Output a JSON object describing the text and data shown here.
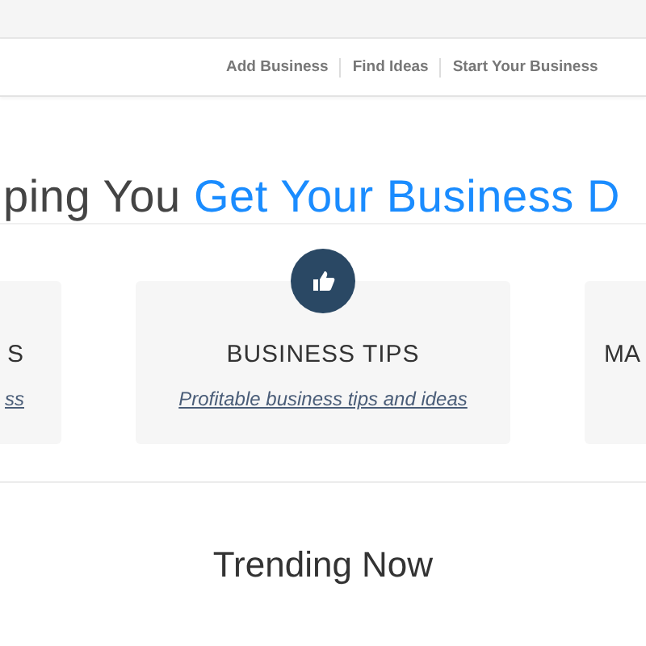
{
  "nav": {
    "links": [
      "Add Business",
      "Find Ideas",
      "Start Your Business"
    ]
  },
  "hero": {
    "heading_plain": "ping You",
    "heading_highlight": "Get Your Business D"
  },
  "cards": [
    {
      "kind": "cut-left",
      "title": "S",
      "link": "ss"
    },
    {
      "kind": "full",
      "title": "BUSINESS TIPS",
      "link": "Profitable business tips and ideas"
    },
    {
      "kind": "cut-right",
      "title": "MA"
    }
  ],
  "trending": {
    "title": "Trending Now"
  }
}
